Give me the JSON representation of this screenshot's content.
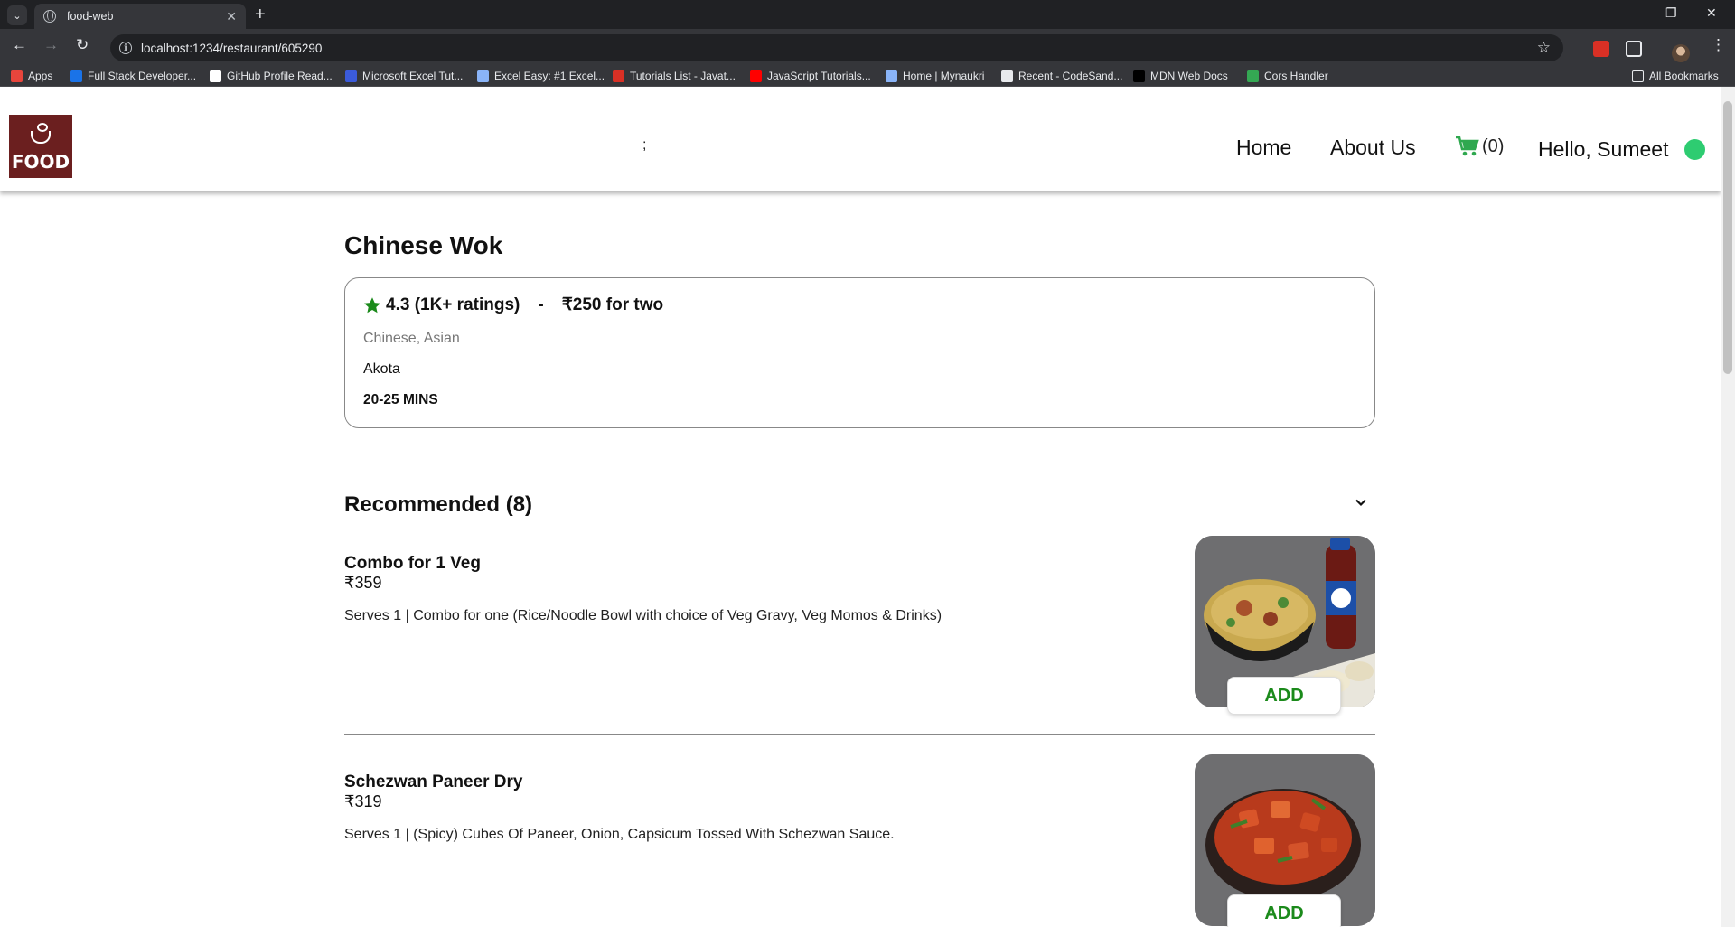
{
  "browser": {
    "tab_title": "food-web",
    "url": "localhost:1234/restaurant/605290",
    "bookmarks": [
      {
        "label": "Apps",
        "icon": "apps-grid-icon",
        "color": "#e8453c"
      },
      {
        "label": "Full Stack Developer...",
        "icon": "site-icon",
        "color": "#1a73e8"
      },
      {
        "label": "GitHub Profile Read...",
        "icon": "site-icon",
        "color": "#ffffff"
      },
      {
        "label": "Microsoft Excel Tut...",
        "icon": "site-icon",
        "color": "#3b5bdb"
      },
      {
        "label": "Excel Easy: #1 Excel...",
        "icon": "site-icon",
        "color": "#8ab4f8"
      },
      {
        "label": "Tutorials List - Javat...",
        "icon": "site-icon",
        "color": "#d93025"
      },
      {
        "label": "JavaScript Tutorials...",
        "icon": "youtube-icon",
        "color": "#ff0000"
      },
      {
        "label": "Home | Mynaukri",
        "icon": "site-icon",
        "color": "#8ab4f8"
      },
      {
        "label": "Recent - CodeSand...",
        "icon": "site-icon",
        "color": "#e8eaed"
      },
      {
        "label": "MDN Web Docs",
        "icon": "site-icon",
        "color": "#000000"
      },
      {
        "label": "Cors Handler",
        "icon": "site-icon",
        "color": "#34a853"
      }
    ],
    "all_bookmarks": "All Bookmarks"
  },
  "header": {
    "logo_text": "FOOD",
    "semicolon": ";",
    "nav": {
      "home": "Home",
      "about": "About Us"
    },
    "cart_count": "(0)",
    "greeting": "Hello, Sumeet",
    "online_color": "#2ecc71"
  },
  "restaurant": {
    "name": "Chinese Wok",
    "rating": "4.3 (1K+ ratings)",
    "separator": "-",
    "cost": "₹250 for two",
    "cuisines": "Chinese, Asian",
    "area": "Akota",
    "delivery_time": "20-25 MINS"
  },
  "menu": {
    "section_title": "Recommended (8)",
    "add_label": "ADD",
    "items": [
      {
        "name": "Combo for 1 Veg",
        "price": "₹359",
        "description": "Serves 1 | Combo for one (Rice/Noodle Bowl with choice of Veg Gravy, Veg Momos & Drinks)"
      },
      {
        "name": "Schezwan Paneer Dry",
        "price": "₹319",
        "description": "Serves 1 | (Spicy) Cubes Of Paneer, Onion, Capsicum Tossed With Schezwan Sauce."
      }
    ]
  },
  "colors": {
    "accent_green": "#1b8a1b",
    "logo_bg": "#6b1f1f"
  }
}
